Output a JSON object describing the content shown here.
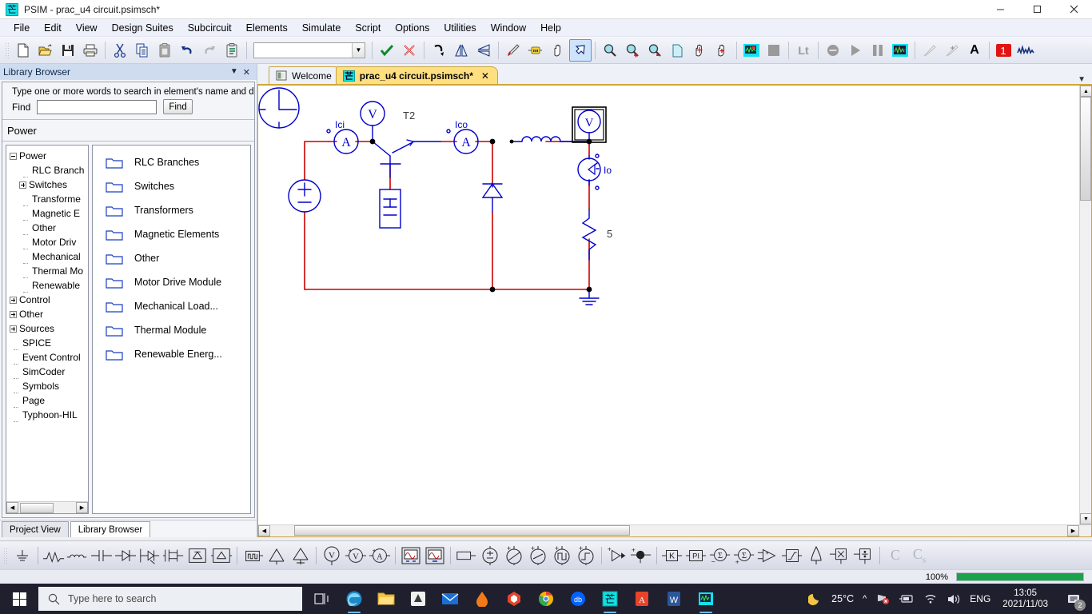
{
  "window": {
    "title": "PSIM - prac_u4 circuit.psimsch*",
    "icon": "psim-app-icon",
    "minimize_label": "─",
    "maximize_label": "☐",
    "close_label": "✕"
  },
  "menubar": {
    "items": [
      "File",
      "Edit",
      "View",
      "Design Suites",
      "Subcircuit",
      "Elements",
      "Simulate",
      "Script",
      "Options",
      "Utilities",
      "Window",
      "Help"
    ]
  },
  "toolbar": {
    "combo_value": "",
    "buttons": [
      {
        "name": "new-file-icon",
        "tip": "New"
      },
      {
        "name": "open-file-icon",
        "tip": "Open"
      },
      {
        "name": "save-icon",
        "tip": "Save"
      },
      {
        "name": "print-icon",
        "tip": "Print"
      },
      {
        "name": "cut-icon",
        "tip": "Cut"
      },
      {
        "name": "copy-icon",
        "tip": "Copy"
      },
      {
        "name": "paste-icon",
        "tip": "Paste"
      },
      {
        "name": "undo-icon",
        "tip": "Undo"
      },
      {
        "name": "redo-icon",
        "tip": "Redo"
      },
      {
        "name": "copy-to-clipboard-icon",
        "tip": "Copy to clipboard"
      },
      {
        "name": "check-icon",
        "tip": "Run"
      },
      {
        "name": "delete-icon",
        "tip": "Cancel"
      },
      {
        "name": "rotate-icon",
        "tip": "Rotate"
      },
      {
        "name": "flip-horizontal-icon",
        "tip": "Mirror"
      },
      {
        "name": "flip-vertical-icon",
        "tip": "Flip"
      },
      {
        "name": "pencil-icon",
        "tip": "Edit"
      },
      {
        "name": "wire-icon",
        "tip": "Place wire"
      },
      {
        "name": "hand-icon",
        "tip": "Pan"
      },
      {
        "name": "select-arrow-icon",
        "tip": "Select"
      },
      {
        "name": "zoom-icon",
        "tip": "Zoom"
      },
      {
        "name": "zoom-in-icon",
        "tip": "Zoom in"
      },
      {
        "name": "zoom-out-icon",
        "tip": "Zoom out"
      },
      {
        "name": "fit-page-icon",
        "tip": "Fit to page"
      },
      {
        "name": "pan-all-icon",
        "tip": "Pan all"
      },
      {
        "name": "pan-add-icon",
        "tip": "Pan add"
      },
      {
        "name": "simview-icon",
        "tip": "Simview"
      },
      {
        "name": "stop-icon",
        "tip": "Stop"
      },
      {
        "name": "lt-icon",
        "tip": "Lt"
      },
      {
        "name": "pause-sim-icon",
        "tip": "Pause"
      },
      {
        "name": "run-sim-icon",
        "tip": "Run simulation"
      },
      {
        "name": "pause-icon",
        "tip": "Pause simulation"
      },
      {
        "name": "waveform-icon",
        "tip": "Waveform"
      },
      {
        "name": "probe-icon",
        "tip": "Probe"
      },
      {
        "name": "measure-icon",
        "tip": "Measure"
      },
      {
        "name": "text-icon",
        "tip": "Text"
      },
      {
        "name": "smart-search-icon",
        "tip": "Smart search"
      },
      {
        "name": "signal-icon",
        "tip": "Signal"
      }
    ]
  },
  "library_browser": {
    "title": "Library Browser",
    "collapse_icon": "chevron-down-icon",
    "close_icon": "close-icon",
    "search_hint": "Type one or more words to search in element's name and  desc",
    "find_label": "Find",
    "find_value": "",
    "find_placeholder": "",
    "find_button": "Find",
    "category": "Power",
    "tree": [
      {
        "label": "Power",
        "level": 0,
        "marker": "minus"
      },
      {
        "label": "RLC Branch",
        "level": 1,
        "marker": "dash"
      },
      {
        "label": "Switches",
        "level": 1,
        "marker": "plus"
      },
      {
        "label": "Transforme",
        "level": 1,
        "marker": "dash"
      },
      {
        "label": "Magnetic E",
        "level": 1,
        "marker": "dash"
      },
      {
        "label": "Other",
        "level": 1,
        "marker": "dash"
      },
      {
        "label": "Motor Driv",
        "level": 1,
        "marker": "dash"
      },
      {
        "label": "Mechanical",
        "level": 1,
        "marker": "dash"
      },
      {
        "label": "Thermal Mo",
        "level": 1,
        "marker": "dash"
      },
      {
        "label": "Renewable",
        "level": 1,
        "marker": "dash"
      },
      {
        "label": "Control",
        "level": 0,
        "marker": "plus"
      },
      {
        "label": "Other",
        "level": 0,
        "marker": "plus"
      },
      {
        "label": "Sources",
        "level": 0,
        "marker": "plus"
      },
      {
        "label": "SPICE",
        "level": 0,
        "marker": "dash"
      },
      {
        "label": "Event Control",
        "level": 0,
        "marker": "dash"
      },
      {
        "label": "SimCoder",
        "level": 0,
        "marker": "dash"
      },
      {
        "label": "Symbols",
        "level": 0,
        "marker": "dash"
      },
      {
        "label": "Page",
        "level": 0,
        "marker": "dash"
      },
      {
        "label": "Typhoon-HIL",
        "level": 0,
        "marker": "dash"
      }
    ],
    "folders": [
      "RLC Branches",
      "Switches",
      "Transformers",
      "Magnetic Elements",
      "Other",
      "Motor Drive Module",
      "Mechanical Load...",
      "Thermal Module",
      "Renewable Energ..."
    ],
    "bottom_tabs": [
      {
        "label": "Project View",
        "selected": false
      },
      {
        "label": "Library Browser",
        "selected": true
      }
    ]
  },
  "document_tabs": [
    {
      "label": "Welcome",
      "selected": false,
      "icon": "welcome-page-icon",
      "closable": false
    },
    {
      "label": "prac_u4 circuit.psimsch*",
      "selected": true,
      "icon": "psim-schematic-icon",
      "closable": true,
      "close_label": "✕"
    }
  ],
  "schematic": {
    "labels": {
      "ammeter_in": "Ici",
      "transistor": "T2",
      "ammeter_out": "Ico",
      "current_probe": "Io",
      "resistor_value": "5"
    },
    "colors": {
      "wire_red": "#cc0000",
      "element_blue": "#0000cc",
      "node_black": "#000000"
    },
    "components": [
      {
        "name": "clock-source",
        "label": ""
      },
      {
        "name": "dc-voltage-source",
        "label": ""
      },
      {
        "name": "ammeter-ici",
        "label": "Ici"
      },
      {
        "name": "voltmeter-t2",
        "label": ""
      },
      {
        "name": "igbt-t2",
        "label": "T2"
      },
      {
        "name": "gating-block",
        "label": ""
      },
      {
        "name": "ammeter-ico",
        "label": "Ico"
      },
      {
        "name": "freewheeling-diode",
        "label": ""
      },
      {
        "name": "inductor",
        "label": ""
      },
      {
        "name": "voltage-probe",
        "label": ""
      },
      {
        "name": "current-sensor-io",
        "label": "Io"
      },
      {
        "name": "resistor",
        "label": "5"
      },
      {
        "name": "ground",
        "label": ""
      }
    ]
  },
  "element_toolbar": {
    "icons": [
      "ground-icon",
      "resistor-icon",
      "inductor-icon",
      "capacitor-icon",
      "diode-icon",
      "thyristor-icon",
      "igbt-icon",
      "single-phase-bridge-icon",
      "three-phase-bridge-icon",
      "square-wave-icon",
      "transformer-1-icon",
      "transformer-2-icon",
      "voltmeter-icon",
      "voltage-sensor-icon",
      "current-sensor-icon",
      "two-channel-scope-icon",
      "one-channel-scope-icon",
      "label-icon",
      "dc-source-icon",
      "ac-source-icon",
      "sine-source-icon",
      "square-source-icon",
      "step-source-icon",
      "opamp-icon",
      "ground-node-icon",
      "probe-node-icon",
      "gain-k-icon",
      "pi-controller-icon",
      "summer-minus-icon",
      "summer-plus-icon",
      "comparator-icon",
      "limiter-icon",
      "bell-icon",
      "multiplier-icon",
      "divider-icon",
      "c-block-icon",
      "cs-block-icon"
    ]
  },
  "statusbar": {
    "zoom": "100%",
    "progress_percent": 100
  },
  "taskbar": {
    "search_placeholder": "Type here to search",
    "search_icon": "search-icon",
    "start_icon": "windows-start-icon",
    "apps": [
      {
        "name": "task-view-icon"
      },
      {
        "name": "edge-icon"
      },
      {
        "name": "file-explorer-icon"
      },
      {
        "name": "store-icon"
      },
      {
        "name": "mail-icon"
      },
      {
        "name": "app-orange-icon"
      },
      {
        "name": "app-red-icon"
      },
      {
        "name": "chrome-icon"
      },
      {
        "name": "dropbox-icon"
      },
      {
        "name": "psim-icon"
      },
      {
        "name": "acrobat-icon"
      },
      {
        "name": "word-icon"
      },
      {
        "name": "simview-icon"
      }
    ],
    "tray": {
      "weather_icon": "moon-icon",
      "temperature": "25°C",
      "chevron": "^",
      "icons": [
        "security-icon",
        "battery-icon",
        "wifi-icon",
        "volume-icon"
      ],
      "language": "ENG",
      "time": "13:05",
      "date": "2021/11/03",
      "notification_icon": "notification-icon",
      "notification_count": "2"
    }
  }
}
